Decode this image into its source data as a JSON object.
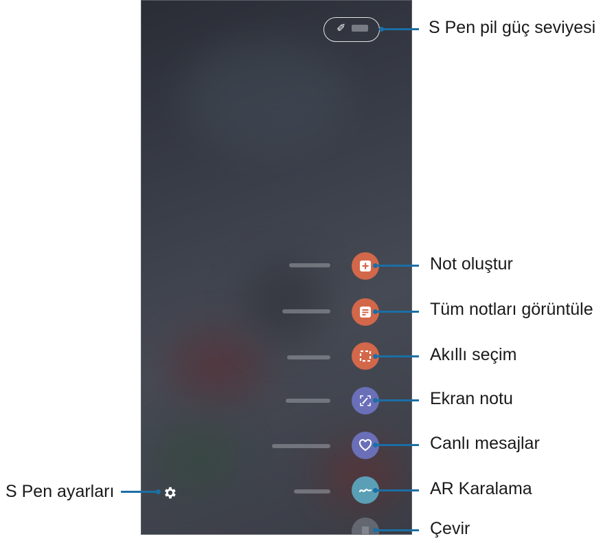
{
  "callouts": {
    "battery": "S Pen pil güç seviyesi",
    "create_note": "Not oluştur",
    "view_all_notes": "Tüm notları görüntüle",
    "smart_select": "Akıllı seçim",
    "screen_write": "Ekran notu",
    "live_messages": "Canlı mesajlar",
    "ar_doodle": "AR Karalama",
    "translate": "Çevir",
    "settings": "S Pen ayarları"
  },
  "icons": {
    "battery": "pen-battery-icon",
    "create_note": "note-plus-icon",
    "view_all_notes": "notes-list-icon",
    "smart_select": "selection-frame-icon",
    "screen_write": "screen-write-icon",
    "live_messages": "heart-message-icon",
    "ar_doodle": "doodle-icon",
    "translate": "translate-icon",
    "settings": "gear-icon"
  },
  "colors": {
    "create_note": "#d2674a",
    "view_all_notes": "#d2674a",
    "smart_select": "#d2674a",
    "screen_write": "#6a6fb8",
    "live_messages": "#6a6fb8",
    "ar_doodle": "#5a9fb5",
    "translate": "#6f7680",
    "leader": "#1a6fa6"
  }
}
